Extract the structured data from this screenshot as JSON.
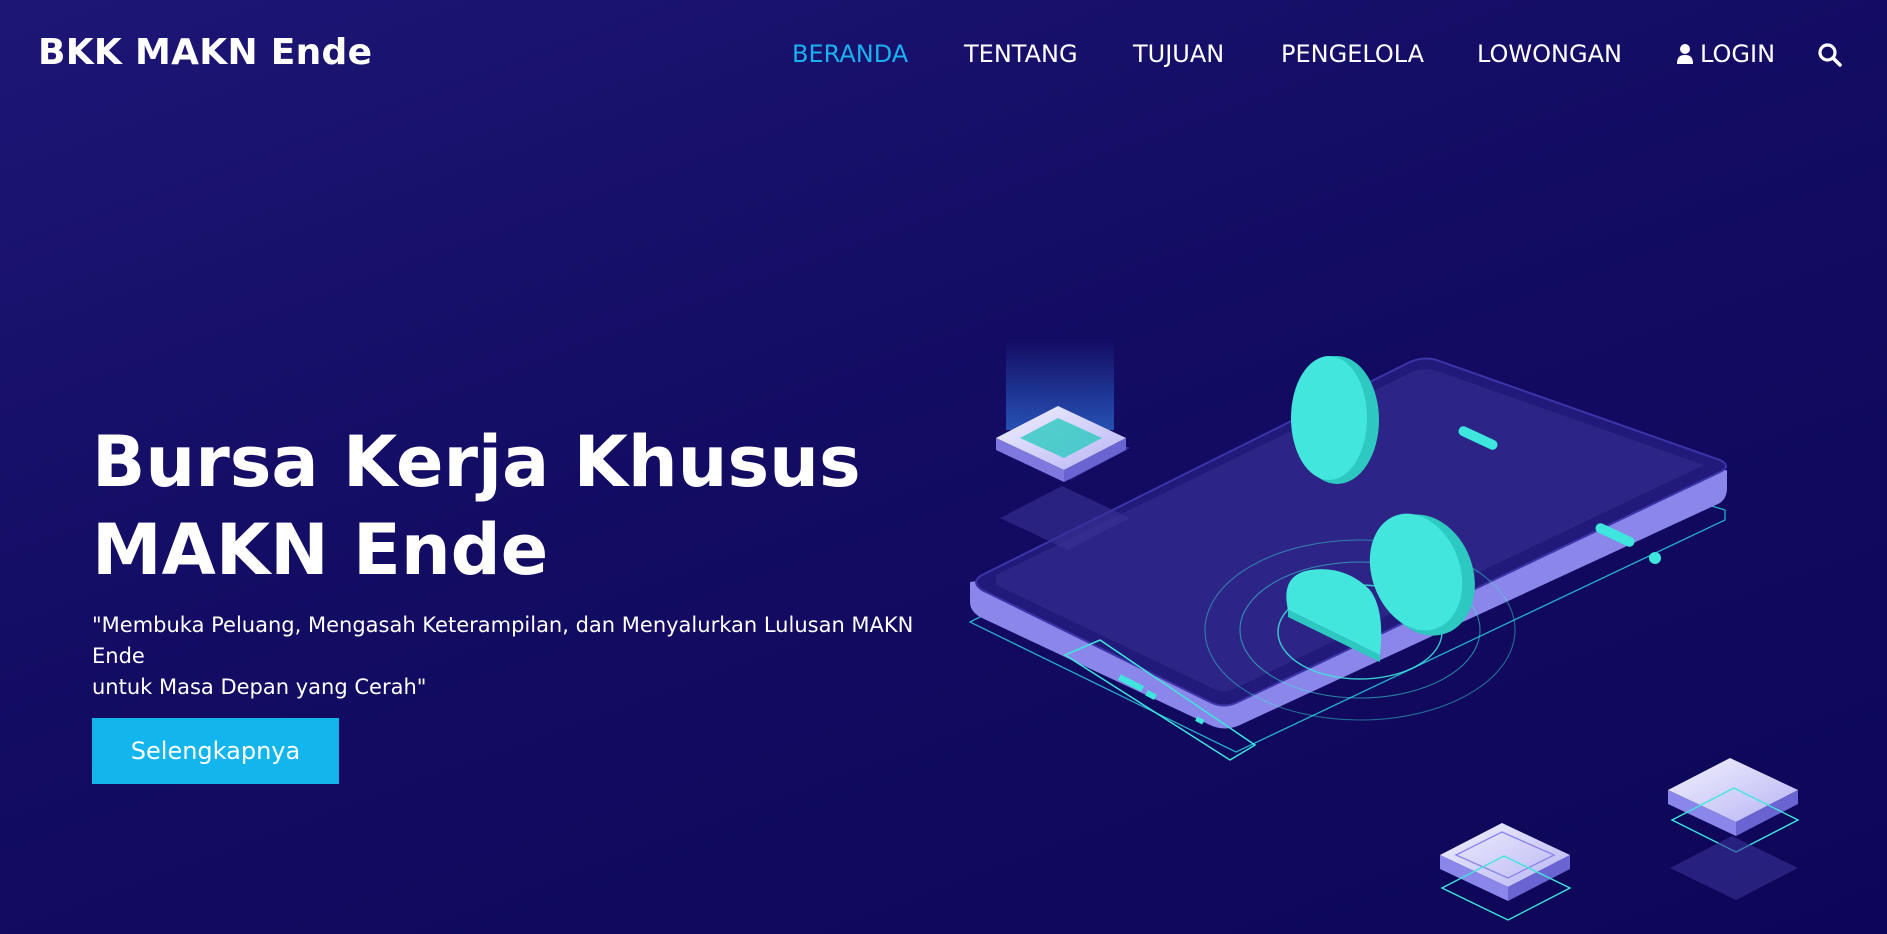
{
  "navbar": {
    "brand": "BKK MAKN Ende",
    "links": [
      {
        "label": "BERANDA",
        "active": true
      },
      {
        "label": "TENTANG",
        "active": false
      },
      {
        "label": "TUJUAN",
        "active": false
      },
      {
        "label": "PENGELOLA",
        "active": false
      },
      {
        "label": "LOWONGAN",
        "active": false
      }
    ],
    "login_label": "LOGIN",
    "login_icon": "user-icon",
    "search_icon": "search-icon"
  },
  "hero": {
    "title_line1": "Bursa Kerja Khusus",
    "title_line2": "MAKN Ende",
    "subtitle_line1": "\"Membuka Peluang, Mengasah Keterampilan, dan Menyalurkan Lulusan MAKN Ende",
    "subtitle_line2": "untuk Masa Depan yang Cerah\"",
    "cta_label": "Selengkapnya",
    "illustration_icon": "isometric-smartphone-illustration"
  },
  "colors": {
    "background_top": "#1d1675",
    "background_bottom": "#0d0658",
    "accent": "#1bb0f0",
    "button": "#12b6ec",
    "teal": "#3fe6dd",
    "phone_lilac": "#8f8be8"
  }
}
